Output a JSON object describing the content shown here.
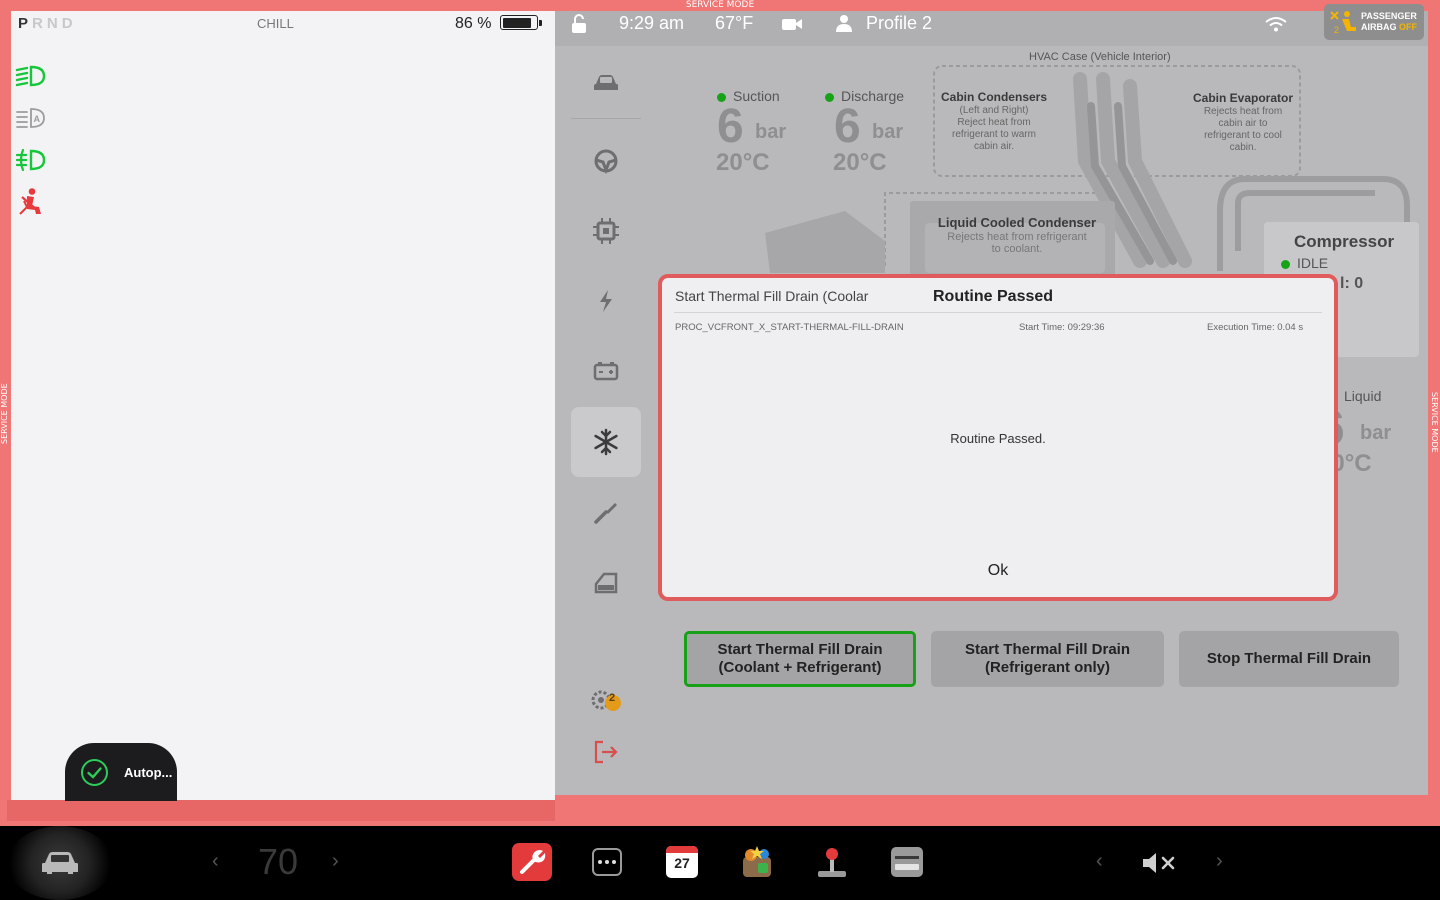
{
  "service_mode_label": "SERVICE MODE",
  "status_bar": {
    "gears": [
      "P",
      "R",
      "N",
      "D"
    ],
    "active_gear": "P",
    "drive_mode": "CHILL",
    "battery_percent": "86 %",
    "battery_level": 0.86
  },
  "autopilot": {
    "label": "Autop..."
  },
  "top_bar": {
    "time": "9:29 am",
    "temperature": "67°F",
    "profile": "Profile 2",
    "airbag_line1": "PASSENGER",
    "airbag_line2": "AIRBAG",
    "airbag_state": "OFF"
  },
  "sidebar": {
    "items": [
      "car-icon",
      "steering-wheel-icon",
      "chip-icon",
      "lightning-icon",
      "battery-icon",
      "snowflake-icon",
      "wrench-icon",
      "door-icon"
    ],
    "selected": "snowflake-icon",
    "alerts_count": "2"
  },
  "thermal": {
    "suction": {
      "label": "Suction",
      "pressure": "6",
      "unit": "bar",
      "temp": "20°C"
    },
    "discharge": {
      "label": "Discharge",
      "pressure": "6",
      "unit": "bar",
      "temp": "20°C"
    },
    "liquid": {
      "label": "Liquid",
      "pressure": "6",
      "unit": "bar",
      "temp": "20°C"
    },
    "hvac_case_title": "HVAC Case (Vehicle Interior)",
    "cabin_condensers": {
      "title": "Cabin Condensers",
      "text": "(Left and Right)\nReject heat from\nrefrigerant to warm\ncabin air."
    },
    "cabin_evaporator": {
      "title": "Cabin Evaporator",
      "text": "Rejects heat from\ncabin air to\nrefrigerant to cool\ncabin."
    },
    "liquid_cooled_condenser": {
      "title": "Liquid Cooled Condenser",
      "text": "Rejects heat from refrigerant\nto coolant."
    },
    "compressor": {
      "title": "Compressor",
      "state": "IDLE",
      "rpm_partial": "l: 0"
    }
  },
  "actions": [
    {
      "label": "Start Thermal Fill Drain\n(Coolant + Refrigerant)",
      "selected": true
    },
    {
      "label": "Start Thermal Fill Drain\n(Refrigerant only)",
      "selected": false
    },
    {
      "label": "Stop Thermal Fill Drain",
      "selected": false
    }
  ],
  "modal": {
    "procedure_title": "Start Thermal Fill Drain (Coolar",
    "title": "Routine Passed",
    "routine_id": "PROC_VCFRONT_X_START-THERMAL-FILL-DRAIN",
    "start_time": "Start Time: 09:29:36",
    "execution_time": "Execution Time: 0.04 s",
    "message": "Routine Passed.",
    "ok_label": "Ok"
  },
  "dock": {
    "speed": "70",
    "calendar_day": "27"
  },
  "colors": {
    "service_frame": "#f07575",
    "accent_green": "#18a118",
    "alert_red": "#e05c5c",
    "airbag_off": "#f5b400"
  }
}
